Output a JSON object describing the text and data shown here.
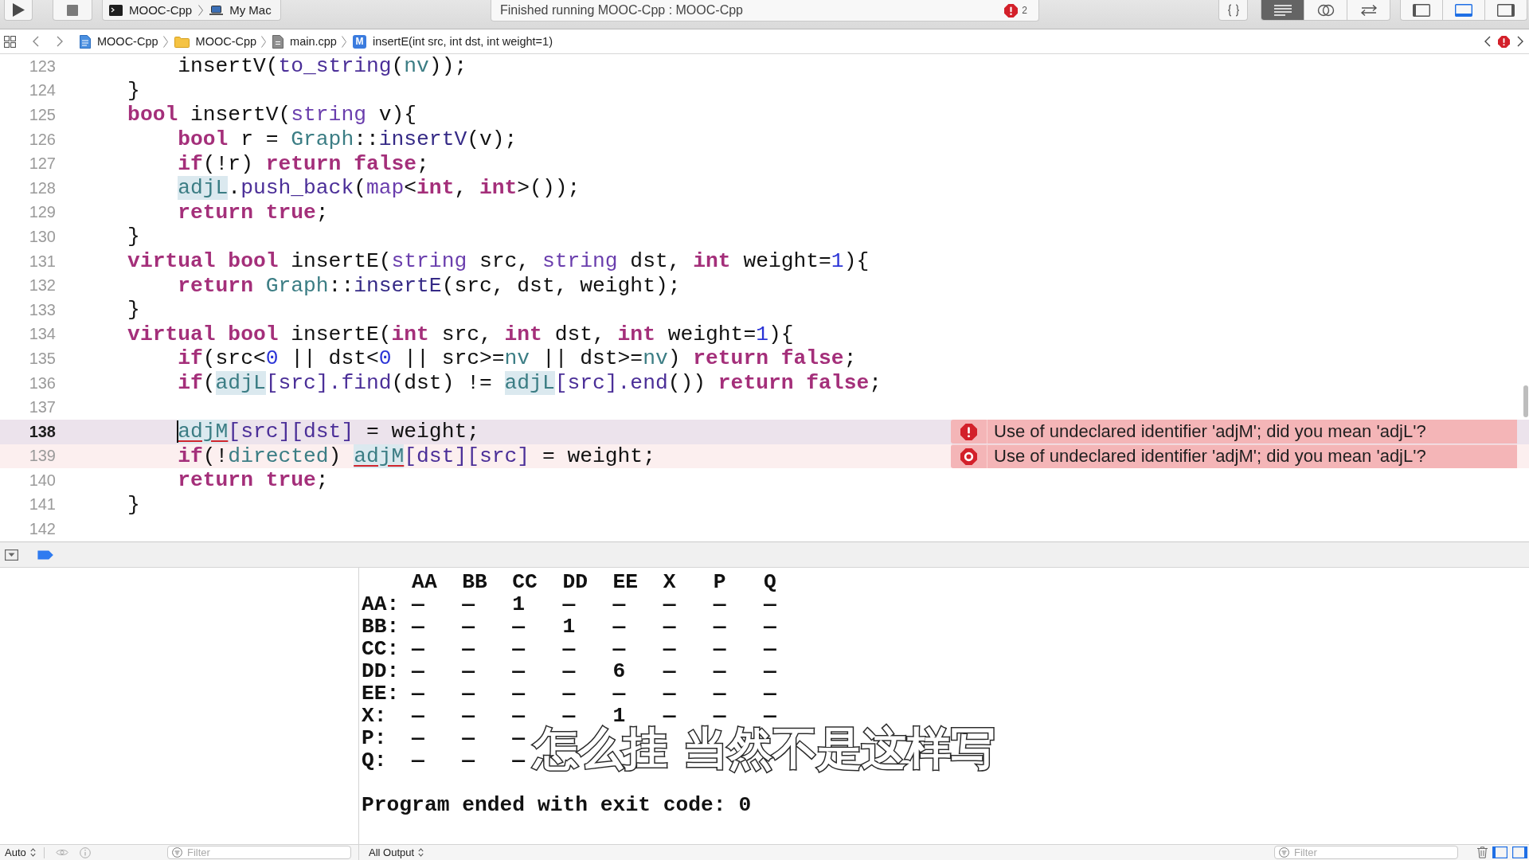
{
  "toolbar": {
    "scheme": {
      "target": "MOOC-Cpp",
      "device": "My Mac"
    },
    "activity": {
      "status": "Finished running MOOC-Cpp : MOOC-Cpp",
      "error_count": "2"
    },
    "editor_modes": [
      {
        "kind": "standard",
        "selected": true
      },
      {
        "kind": "assistant",
        "selected": false
      },
      {
        "kind": "version",
        "selected": false
      }
    ],
    "panels": [
      {
        "kind": "navigator",
        "on": false
      },
      {
        "kind": "debug",
        "on": true
      },
      {
        "kind": "utilities",
        "on": false
      }
    ]
  },
  "jump_bar": {
    "path": [
      {
        "kind": "project",
        "label": "MOOC-Cpp"
      },
      {
        "kind": "folder",
        "label": "MOOC-Cpp"
      },
      {
        "kind": "file",
        "label": "main.cpp"
      },
      {
        "kind": "method",
        "symbol": "M",
        "label": "insertE(int src, int dst, int weight=1)"
      }
    ]
  },
  "editor": {
    "lines": [
      {
        "number": "123",
        "kind": "normal",
        "tokens": [
          {
            "text": "        insertV(",
            "kind": "plain"
          },
          {
            "text": "to_string",
            "kind": "sys"
          },
          {
            "text": "(",
            "kind": "plain"
          },
          {
            "text": "nv",
            "kind": "proj"
          },
          {
            "text": "));",
            "kind": "plain"
          }
        ]
      },
      {
        "number": "124",
        "kind": "normal",
        "tokens": [
          {
            "text": "    }",
            "kind": "plain"
          }
        ]
      },
      {
        "number": "125",
        "kind": "normal",
        "tokens": [
          {
            "text": "    bool",
            "kind": "kw"
          },
          {
            "text": " insertV(",
            "kind": "plain"
          },
          {
            "text": "string",
            "kind": "type"
          },
          {
            "text": " v){",
            "kind": "plain"
          }
        ]
      },
      {
        "number": "126",
        "kind": "normal",
        "tokens": [
          {
            "text": "        bool",
            "kind": "kw"
          },
          {
            "text": " r = ",
            "kind": "plain"
          },
          {
            "text": "Graph",
            "kind": "proj"
          },
          {
            "text": "::",
            "kind": "plain"
          },
          {
            "text": "insertV",
            "kind": "func"
          },
          {
            "text": "(v);",
            "kind": "plain"
          }
        ]
      },
      {
        "number": "127",
        "kind": "normal",
        "tokens": [
          {
            "text": "        if",
            "kind": "kw"
          },
          {
            "text": "(!r) ",
            "kind": "plain"
          },
          {
            "text": "return false",
            "kind": "kw"
          },
          {
            "text": ";",
            "kind": "plain"
          }
        ]
      },
      {
        "number": "128",
        "kind": "normal",
        "tokens": [
          {
            "text": "        adjL",
            "kind": "match"
          },
          {
            "text": ".",
            "kind": "plain"
          },
          {
            "text": "push_back",
            "kind": "sys"
          },
          {
            "text": "(",
            "kind": "plain"
          },
          {
            "text": "map",
            "kind": "type"
          },
          {
            "text": "<",
            "kind": "plain"
          },
          {
            "text": "int",
            "kind": "kw"
          },
          {
            "text": ", ",
            "kind": "plain"
          },
          {
            "text": "int",
            "kind": "kw"
          },
          {
            "text": ">());",
            "kind": "plain"
          }
        ]
      },
      {
        "number": "129",
        "kind": "normal",
        "tokens": [
          {
            "text": "        return true",
            "kind": "kw"
          },
          {
            "text": ";",
            "kind": "plain"
          }
        ]
      },
      {
        "number": "130",
        "kind": "normal",
        "tokens": [
          {
            "text": "    }",
            "kind": "plain"
          }
        ]
      },
      {
        "number": "131",
        "kind": "normal",
        "tokens": [
          {
            "text": "    virtual bool",
            "kind": "kw"
          },
          {
            "text": " insertE(",
            "kind": "plain"
          },
          {
            "text": "string",
            "kind": "type"
          },
          {
            "text": " src, ",
            "kind": "plain"
          },
          {
            "text": "string",
            "kind": "type"
          },
          {
            "text": " dst, ",
            "kind": "plain"
          },
          {
            "text": "int",
            "kind": "kw"
          },
          {
            "text": " weight=",
            "kind": "plain"
          },
          {
            "text": "1",
            "kind": "num"
          },
          {
            "text": "){",
            "kind": "plain"
          }
        ]
      },
      {
        "number": "132",
        "kind": "normal",
        "tokens": [
          {
            "text": "        return",
            "kind": "kw"
          },
          {
            "text": " Graph",
            "kind": "proj"
          },
          {
            "text": "::",
            "kind": "plain"
          },
          {
            "text": "insertE",
            "kind": "func"
          },
          {
            "text": "(src, dst, weight);",
            "kind": "plain"
          }
        ]
      },
      {
        "number": "133",
        "kind": "normal",
        "tokens": [
          {
            "text": "    }",
            "kind": "plain"
          }
        ]
      },
      {
        "number": "134",
        "kind": "normal",
        "tokens": [
          {
            "text": "    virtual bool",
            "kind": "kw"
          },
          {
            "text": " insertE(",
            "kind": "plain"
          },
          {
            "text": "int",
            "kind": "kw"
          },
          {
            "text": " src, ",
            "kind": "plain"
          },
          {
            "text": "int",
            "kind": "kw"
          },
          {
            "text": " dst, ",
            "kind": "plain"
          },
          {
            "text": "int",
            "kind": "kw"
          },
          {
            "text": " weight=",
            "kind": "plain"
          },
          {
            "text": "1",
            "kind": "num"
          },
          {
            "text": "){",
            "kind": "plain"
          }
        ]
      },
      {
        "number": "135",
        "kind": "normal",
        "tokens": [
          {
            "text": "        if",
            "kind": "kw"
          },
          {
            "text": "(src<",
            "kind": "plain"
          },
          {
            "text": "0",
            "kind": "num"
          },
          {
            "text": " || dst<",
            "kind": "plain"
          },
          {
            "text": "0",
            "kind": "num"
          },
          {
            "text": " || src>=",
            "kind": "plain"
          },
          {
            "text": "nv",
            "kind": "proj"
          },
          {
            "text": " || dst>=",
            "kind": "plain"
          },
          {
            "text": "nv",
            "kind": "proj"
          },
          {
            "text": ") ",
            "kind": "plain"
          },
          {
            "text": "return false",
            "kind": "kw"
          },
          {
            "text": ";",
            "kind": "plain"
          }
        ]
      },
      {
        "number": "136",
        "kind": "normal",
        "tokens": [
          {
            "text": "        if",
            "kind": "kw"
          },
          {
            "text": "(",
            "kind": "plain"
          },
          {
            "text": "adjL",
            "kind": "match"
          },
          {
            "text": "[src].",
            "kind": "sys"
          },
          {
            "text": "find",
            "kind": "sys"
          },
          {
            "text": "(dst) != ",
            "kind": "plain"
          },
          {
            "text": "adjL",
            "kind": "match"
          },
          {
            "text": "[src].",
            "kind": "sys"
          },
          {
            "text": "end",
            "kind": "sys"
          },
          {
            "text": "()) ",
            "kind": "plain"
          },
          {
            "text": "return false",
            "kind": "kw"
          },
          {
            "text": ";",
            "kind": "plain"
          }
        ]
      },
      {
        "number": "137",
        "kind": "normal"
      },
      {
        "number": "138",
        "kind": "current",
        "tokens": [
          {
            "text": "        adjM",
            "kind": "error"
          },
          {
            "text": "[src][dst]",
            "kind": "sys"
          },
          {
            "text": " = weight;",
            "kind": "plain"
          }
        ],
        "issue": {
          "kind": "error",
          "message": "Use of undeclared identifier 'adjM'; did you mean 'adjL'?"
        }
      },
      {
        "number": "139",
        "kind": "error",
        "tokens": [
          {
            "text": "        if",
            "kind": "kw"
          },
          {
            "text": "(!",
            "kind": "plain"
          },
          {
            "text": "directed",
            "kind": "proj"
          },
          {
            "text": ") ",
            "kind": "plain"
          },
          {
            "text": "adjM",
            "kind": "error"
          },
          {
            "text": "[dst][src]",
            "kind": "sys"
          },
          {
            "text": " = weight;",
            "kind": "plain"
          }
        ],
        "issue": {
          "kind": "fixit",
          "message": "Use of undeclared identifier 'adjM'; did you mean 'adjL'?"
        }
      },
      {
        "number": "140",
        "kind": "normal",
        "tokens": [
          {
            "text": "        return true",
            "kind": "kw"
          },
          {
            "text": ";",
            "kind": "plain"
          }
        ]
      },
      {
        "number": "141",
        "kind": "normal",
        "tokens": [
          {
            "text": "    }",
            "kind": "plain"
          }
        ]
      },
      {
        "number": "142",
        "kind": "normal"
      }
    ]
  },
  "debug_bar": {
    "breakpoints": {
      "on": true
    }
  },
  "debug_area": {
    "variables_scope": "Auto",
    "variables_filter": {
      "placeholder": "Filter"
    },
    "output_scope": "All Output",
    "console_filter": {
      "placeholder": "Filter"
    },
    "split": [
      {
        "kind": "variables",
        "on": true
      },
      {
        "kind": "console",
        "on": true
      }
    ],
    "console": {
      "columns": [
        "AA",
        "BB",
        "CC",
        "DD",
        "EE",
        "X",
        "P",
        "Q"
      ],
      "rows": [
        {
          "label": "AA:",
          "cells": [
            "—",
            "—",
            "1",
            "—",
            "—",
            "—",
            "—",
            "—"
          ]
        },
        {
          "label": "BB:",
          "cells": [
            "—",
            "—",
            "—",
            "1",
            "—",
            "—",
            "—",
            "—"
          ]
        },
        {
          "label": "CC:",
          "cells": [
            "—",
            "—",
            "—",
            "—",
            "—",
            "—",
            "—",
            "—"
          ]
        },
        {
          "label": "DD:",
          "cells": [
            "—",
            "—",
            "—",
            "—",
            "6",
            "—",
            "—",
            "—"
          ]
        },
        {
          "label": "EE:",
          "cells": [
            "—",
            "—",
            "—",
            "—",
            "—",
            "—",
            "—",
            "—"
          ]
        },
        {
          "label": "X:",
          "cells": [
            "—",
            "—",
            "—",
            "—",
            "1",
            "—",
            "—",
            "—"
          ]
        },
        {
          "label": "P:",
          "cells": [
            "—",
            "—",
            "—"
          ]
        },
        {
          "label": "Q:",
          "cells": [
            "—",
            "—",
            "—"
          ]
        }
      ],
      "exit_message": "Program ended with exit code: 0"
    }
  },
  "subtitle": "怎么挂 当然不是这样写"
}
